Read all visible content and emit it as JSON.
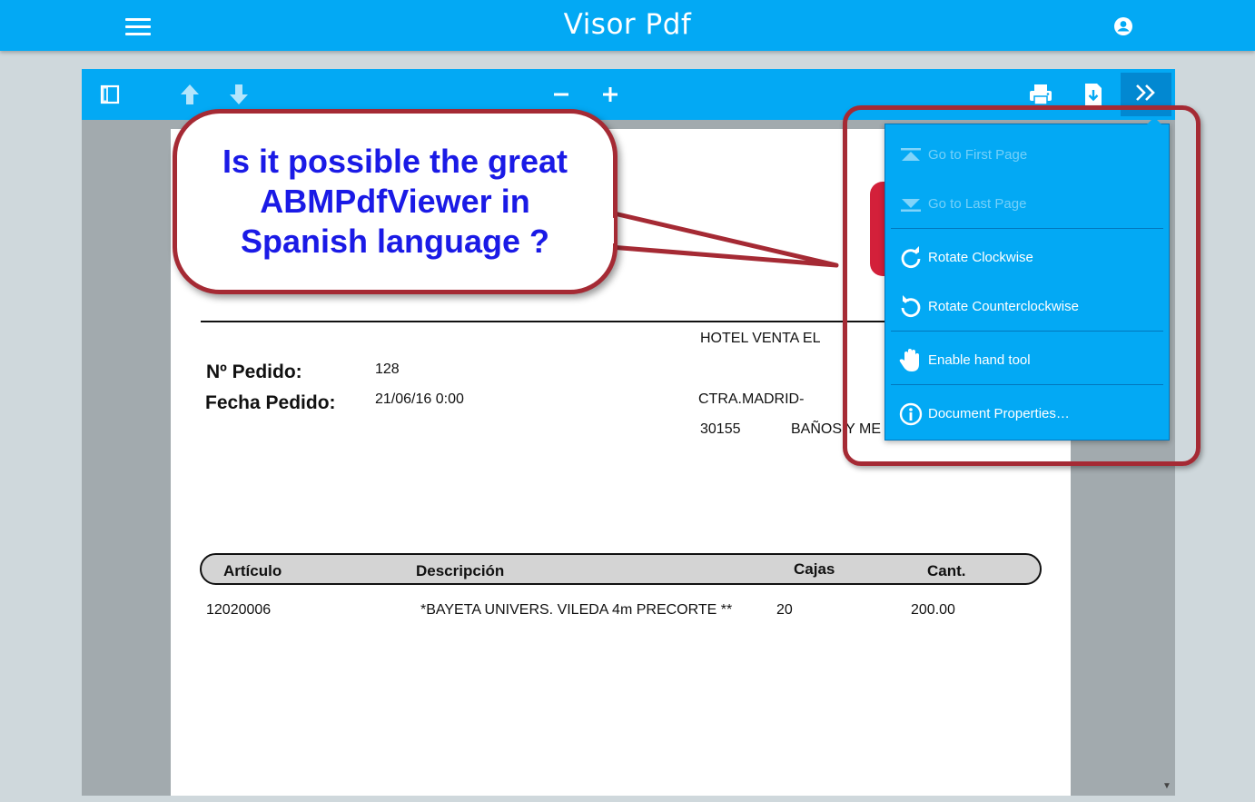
{
  "appbar": {
    "title": "Visor Pdf",
    "menu_icon": "hamburger-menu-icon",
    "user_icon": "account-circle-icon",
    "color": "#03a9f4"
  },
  "toolbar": {
    "color": "#03a9f4",
    "buttons": [
      "sidebar-toggle-icon",
      "previous-page-icon",
      "next-page-icon",
      "zoom-out-icon",
      "zoom-in-icon",
      "print-icon",
      "download-icon",
      "secondary-toolbar-icon"
    ]
  },
  "document": {
    "header_right": "HOTEL VENTA EL",
    "order_label": "Nº Pedido:",
    "order_value": "128",
    "date_label": "Fecha Pedido:",
    "date_value": "21/06/16 0:00",
    "address_line1": "CTRA.MADRID-",
    "postal_code": "30155",
    "city": "BAÑOS Y ME",
    "table": {
      "headers": [
        "Artículo",
        "Descripción",
        "Cajas",
        "Cant."
      ],
      "rows": [
        [
          "12020006",
          "*BAYETA UNIVERS. VILEDA 4m PRECORTE **",
          "20",
          "200.00"
        ]
      ]
    }
  },
  "dropdown": {
    "items": [
      {
        "label": "Go to First Page",
        "icon": "first-page-icon",
        "disabled": true
      },
      {
        "label": "Go to Last Page",
        "icon": "last-page-icon",
        "disabled": true
      },
      {
        "label": "Rotate Clockwise",
        "icon": "rotate-clockwise-icon",
        "disabled": false
      },
      {
        "label": "Rotate Counterclockwise",
        "icon": "rotate-counterclockwise-icon",
        "disabled": false
      },
      {
        "label": "Enable hand tool",
        "icon": "hand-tool-icon",
        "disabled": false
      },
      {
        "label": "Document Properties…",
        "icon": "info-icon",
        "disabled": false
      }
    ]
  },
  "annotation": {
    "text": "Is it possible the great ABMPdfViewer in Spanish language ?",
    "border_color": "#a52a34",
    "text_color": "#1a1ae6"
  }
}
